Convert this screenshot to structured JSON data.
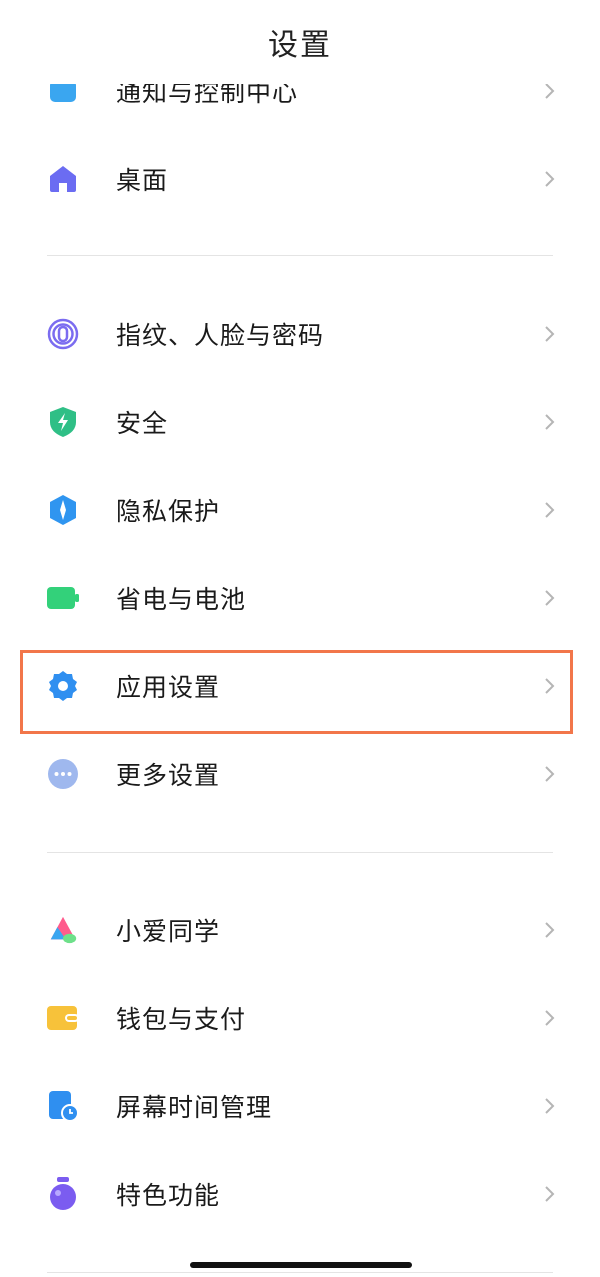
{
  "header": {
    "title": "设置"
  },
  "items": [
    {
      "id": "notifications",
      "label": "通知与控制中心",
      "icon": "notification-icon",
      "color": "#3aa6f0"
    },
    {
      "id": "desktop",
      "label": "桌面",
      "icon": "home-icon",
      "color": "#6b6cf2"
    },
    {
      "id": "fingerprint",
      "label": "指纹、人脸与密码",
      "icon": "fingerprint-icon",
      "color": "#7b6cf0"
    },
    {
      "id": "security",
      "label": "安全",
      "icon": "shield-icon",
      "color": "#2fbf86"
    },
    {
      "id": "privacy",
      "label": "隐私保护",
      "icon": "privacy-icon",
      "color": "#2f95f0"
    },
    {
      "id": "battery",
      "label": "省电与电池",
      "icon": "battery-icon",
      "color": "#33d17a"
    },
    {
      "id": "app-settings",
      "label": "应用设置",
      "icon": "gear-icon",
      "color": "#2f8ff0"
    },
    {
      "id": "more-settings",
      "label": "更多设置",
      "icon": "more-icon",
      "color": "#9fb8ee"
    },
    {
      "id": "xiaoai",
      "label": "小爱同学",
      "icon": "xiaoai-icon",
      "color": "#ff5b8c"
    },
    {
      "id": "wallet",
      "label": "钱包与支付",
      "icon": "wallet-icon",
      "color": "#f7c23a"
    },
    {
      "id": "screen-time",
      "label": "屏幕时间管理",
      "icon": "screen-time-icon",
      "color": "#2f8ff0"
    },
    {
      "id": "features",
      "label": "特色功能",
      "icon": "features-icon",
      "color": "#7b5cf0"
    }
  ],
  "highlighted_item": "应用设置"
}
